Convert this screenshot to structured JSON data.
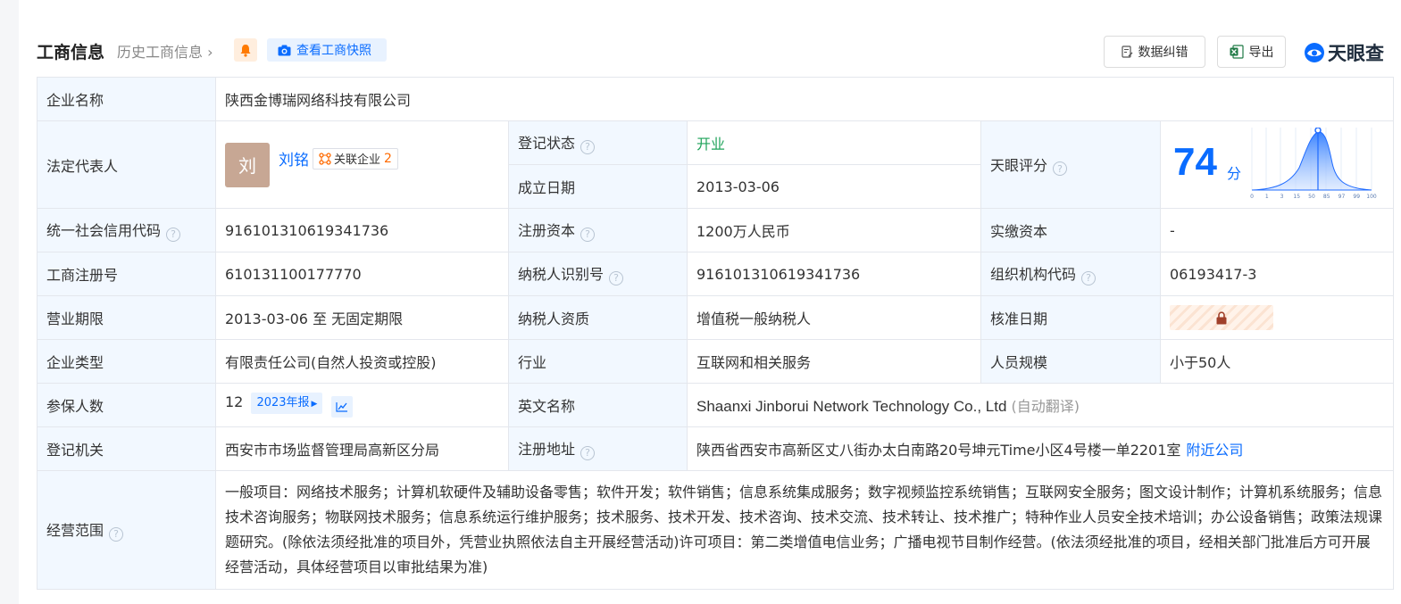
{
  "header": {
    "title": "工商信息",
    "history_link": "历史工商信息",
    "snapshot_label": "查看工商快照",
    "correct_label": "数据纠错",
    "export_label": "导出",
    "brand_name": "天眼查"
  },
  "labels": {
    "company_name": "企业名称",
    "legal_rep": "法定代表人",
    "reg_status": "登记状态",
    "est_date": "成立日期",
    "tianyan_score": "天眼评分",
    "credit_code": "统一社会信用代码",
    "reg_capital": "注册资本",
    "paid_capital": "实缴资本",
    "reg_no": "工商注册号",
    "taxpayer_id": "纳税人识别号",
    "org_code": "组织机构代码",
    "biz_term": "营业期限",
    "taxpayer_qual": "纳税人资质",
    "approve_date": "核准日期",
    "company_type": "企业类型",
    "industry": "行业",
    "staff_size": "人员规模",
    "insured": "参保人数",
    "english_name": "英文名称",
    "reg_authority": "登记机关",
    "reg_address": "注册地址",
    "biz_scope": "经营范围"
  },
  "values": {
    "company_name": "陕西金博瑞网络科技有限公司",
    "legal_rep_avatar": "刘",
    "legal_rep_name": "刘铭",
    "related_label": "关联企业",
    "related_count": "2",
    "reg_status": "开业",
    "est_date": "2013-03-06",
    "score": "74",
    "score_unit": "分",
    "credit_code": "916101310619341736",
    "reg_capital": "1200万人民币",
    "paid_capital": "-",
    "reg_no": "610131100177770",
    "taxpayer_id": "916101310619341736",
    "org_code": "06193417-3",
    "biz_term": "2013-03-06 至 无固定期限",
    "taxpayer_qual": "增值税一般纳税人",
    "company_type": "有限责任公司(自然人投资或控股)",
    "industry": "互联网和相关服务",
    "staff_size": "小于50人",
    "insured": "12",
    "insured_year": "2023年报",
    "english_name": "Shaanxi Jinborui Network Technology Co., Ltd",
    "english_note": "(自动翻译)",
    "reg_authority": "西安市市场监督管理局高新区分局",
    "reg_address": "陕西省西安市高新区丈八街办太白南路20号坤元Time小区4号楼一单2201室",
    "nearby_link": "附近公司",
    "biz_scope": "一般项目：网络技术服务；计算机软硬件及辅助设备零售；软件开发；软件销售；信息系统集成服务；数字视频监控系统销售；互联网安全服务；图文设计制作；计算机系统服务；信息技术咨询服务；物联网技术服务；信息系统运行维护服务；技术服务、技术开发、技术咨询、技术交流、技术转让、技术推广；特种作业人员安全技术培训；办公设备销售；政策法规课题研究。(除依法须经批准的项目外，凭营业执照依法自主开展经营活动)许可项目：第二类增值电信业务；广播电视节目制作经营。(依法须经批准的项目，经相关部门批准后方可开展经营活动，具体经营项目以审批结果为准)"
  },
  "score_chart": {
    "ticks": [
      "0",
      "1",
      "3",
      "15",
      "50",
      "85",
      "97",
      "99",
      "100"
    ],
    "marker_value": 74
  },
  "colors": {
    "accent": "#0a6cff",
    "label_bg": "#f2f8ff",
    "status_open": "#1fa35a",
    "border": "#e4e7ed"
  }
}
